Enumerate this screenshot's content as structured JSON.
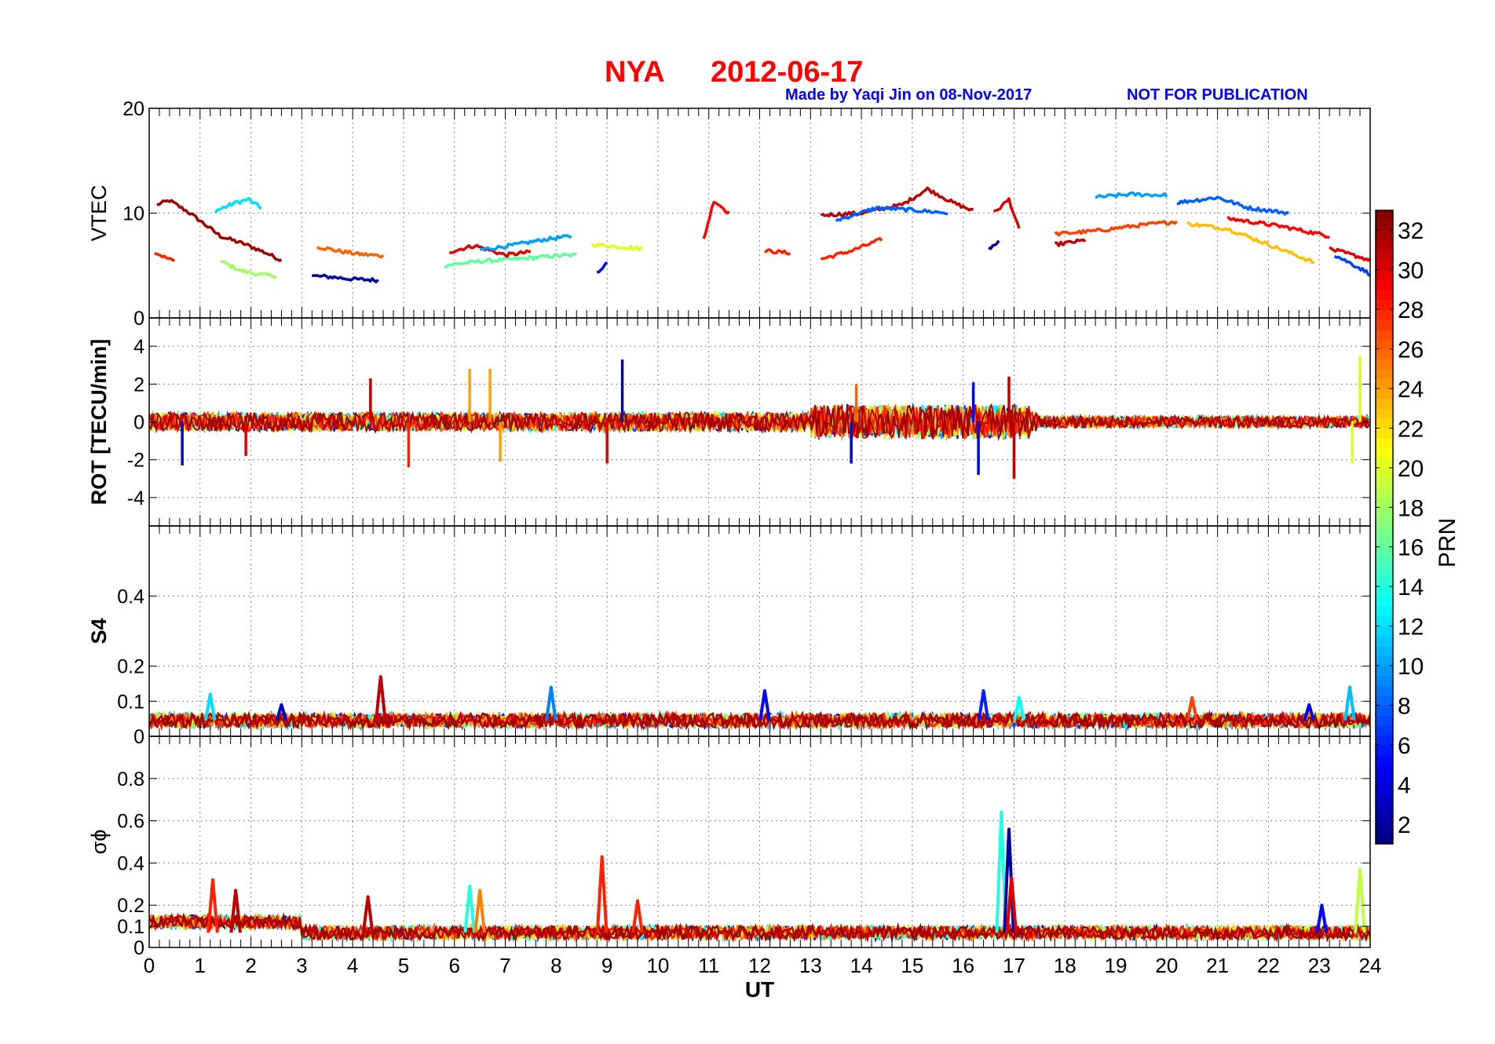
{
  "title": {
    "station": "NYA",
    "date": "2012-06-17"
  },
  "credit": {
    "made_by": "Made by Yaqi Jin on 08-Nov-2017",
    "notice": "NOT FOR PUBLICATION"
  },
  "colorbar": {
    "label": "PRN",
    "ticks": [
      "2",
      "4",
      "6",
      "8",
      "10",
      "12",
      "14",
      "16",
      "18",
      "20",
      "22",
      "24",
      "26",
      "28",
      "30",
      "32"
    ],
    "range": [
      1,
      33
    ],
    "colormap": "jet"
  },
  "chart_data": [
    {
      "type": "line",
      "panel": "vtec",
      "ylabel": "VTEC",
      "ylim": [
        0,
        20
      ],
      "yticks": [
        "0",
        "10",
        "20"
      ],
      "xlim": [
        0,
        24
      ],
      "grid": true,
      "series": [
        {
          "prn": 32,
          "x": [
            0.15,
            0.4,
            0.8,
            1.4,
            1.9,
            2.3,
            2.6
          ],
          "y": [
            10.8,
            11.2,
            10.0,
            7.8,
            7.0,
            6.2,
            5.5
          ]
        },
        {
          "prn": 28,
          "x": [
            0.1,
            0.3,
            0.5
          ],
          "y": [
            6.3,
            5.8,
            5.4
          ]
        },
        {
          "prn": 12,
          "x": [
            1.3,
            1.7,
            1.95,
            2.2
          ],
          "y": [
            10.2,
            11.0,
            11.3,
            10.5
          ]
        },
        {
          "prn": 18,
          "x": [
            1.4,
            1.8,
            2.2,
            2.5
          ],
          "y": [
            5.4,
            4.5,
            4.1,
            4.0
          ]
        },
        {
          "prn": 2,
          "x": [
            3.2,
            3.6,
            4.0,
            4.5
          ],
          "y": [
            4.0,
            3.9,
            3.7,
            3.6
          ]
        },
        {
          "prn": 26,
          "x": [
            3.3,
            3.7,
            4.1,
            4.6
          ],
          "y": [
            6.8,
            6.4,
            6.1,
            5.9
          ]
        },
        {
          "prn": 16,
          "x": [
            5.8,
            6.5,
            7.2,
            7.9,
            8.4
          ],
          "y": [
            5.0,
            5.4,
            5.6,
            5.9,
            6.0
          ]
        },
        {
          "prn": 30,
          "x": [
            5.9,
            6.4,
            7.0,
            7.5
          ],
          "y": [
            6.3,
            6.9,
            6.0,
            6.3
          ]
        },
        {
          "prn": 10,
          "x": [
            6.5,
            7.1,
            7.8,
            8.3
          ],
          "y": [
            6.5,
            6.9,
            7.5,
            7.8
          ]
        },
        {
          "prn": 20,
          "x": [
            8.7,
            9.2,
            9.7
          ],
          "y": [
            7.0,
            6.8,
            6.6
          ]
        },
        {
          "prn": 4,
          "x": [
            8.8,
            9.0
          ],
          "y": [
            4.4,
            5.2
          ]
        },
        {
          "prn": 29,
          "x": [
            10.9,
            11.1,
            11.4
          ],
          "y": [
            7.5,
            11.2,
            10.0
          ]
        },
        {
          "prn": 28,
          "x": [
            12.1,
            12.6
          ],
          "y": [
            6.4,
            6.2
          ]
        },
        {
          "prn": 28,
          "x": [
            13.2,
            13.8,
            14.4
          ],
          "y": [
            5.6,
            6.4,
            7.5
          ]
        },
        {
          "prn": 31,
          "x": [
            13.2,
            14.0,
            14.8,
            15.3,
            15.8,
            16.2
          ],
          "y": [
            9.8,
            10.0,
            10.8,
            12.3,
            11.0,
            10.2
          ]
        },
        {
          "prn": 8,
          "x": [
            13.5,
            14.3,
            15.0,
            15.7
          ],
          "y": [
            9.3,
            10.5,
            10.3,
            10.0
          ]
        },
        {
          "prn": 30,
          "x": [
            16.6,
            16.9,
            17.1
          ],
          "y": [
            10.0,
            11.3,
            8.4
          ]
        },
        {
          "prn": 2,
          "x": [
            16.5,
            16.7
          ],
          "y": [
            6.6,
            7.2
          ]
        },
        {
          "prn": 31,
          "x": [
            17.8,
            18.4
          ],
          "y": [
            7.0,
            7.4
          ]
        },
        {
          "prn": 10,
          "x": [
            18.6,
            19.3,
            20.0
          ],
          "y": [
            11.5,
            11.8,
            11.7
          ]
        },
        {
          "prn": 27,
          "x": [
            17.8,
            18.6,
            19.4,
            20.2
          ],
          "y": [
            8.0,
            8.3,
            8.8,
            9.2
          ]
        },
        {
          "prn": 8,
          "x": [
            20.2,
            21.0,
            21.6,
            22.4
          ],
          "y": [
            11.0,
            11.5,
            10.5,
            10.0
          ]
        },
        {
          "prn": 23,
          "x": [
            20.4,
            21.2,
            22.0,
            22.9
          ],
          "y": [
            9.0,
            8.5,
            7.0,
            5.3
          ]
        },
        {
          "prn": 29,
          "x": [
            21.2,
            22.3,
            23.2
          ],
          "y": [
            9.5,
            8.7,
            7.8
          ]
        },
        {
          "prn": 7,
          "x": [
            23.3,
            23.7,
            24.0
          ],
          "y": [
            6.0,
            5.0,
            4.2
          ]
        },
        {
          "prn": 30,
          "x": [
            23.2,
            23.8,
            24.0
          ],
          "y": [
            6.6,
            5.8,
            5.5
          ]
        }
      ]
    },
    {
      "type": "line",
      "panel": "rot",
      "ylabel": "ROT [TECU/min]",
      "ylim": [
        -5.5,
        5.5
      ],
      "yticks": [
        "-4",
        "-2",
        "0",
        "2",
        "4"
      ],
      "xlim": [
        0,
        24
      ],
      "grid": true,
      "spikes": [
        {
          "prn": 3,
          "x": 0.65,
          "y": -2.3
        },
        {
          "prn": 30,
          "x": 1.9,
          "y": -1.8
        },
        {
          "prn": 31,
          "x": 4.35,
          "y": 2.3
        },
        {
          "prn": 28,
          "x": 5.1,
          "y": -2.4
        },
        {
          "prn": 24,
          "x": 6.3,
          "y": 2.8
        },
        {
          "prn": 24,
          "x": 6.7,
          "y": 2.8
        },
        {
          "prn": 24,
          "x": 6.9,
          "y": -2.1
        },
        {
          "prn": 3,
          "x": 9.3,
          "y": 3.3
        },
        {
          "prn": 30,
          "x": 9.0,
          "y": -2.2
        },
        {
          "prn": 26,
          "x": 13.9,
          "y": 2.0
        },
        {
          "prn": 4,
          "x": 13.8,
          "y": -2.2
        },
        {
          "prn": 4,
          "x": 16.2,
          "y": 2.1
        },
        {
          "prn": 4,
          "x": 16.3,
          "y": -2.8
        },
        {
          "prn": 31,
          "x": 16.9,
          "y": 2.4
        },
        {
          "prn": 31,
          "x": 17.0,
          "y": -3.0
        },
        {
          "prn": 20,
          "x": 23.8,
          "y": 3.5
        },
        {
          "prn": 20,
          "x": 23.65,
          "y": -2.2
        }
      ]
    },
    {
      "type": "line",
      "panel": "s4",
      "ylabel": "S4",
      "ylim": [
        0,
        0.6
      ],
      "yticks": [
        "0",
        "0.1",
        "0.2",
        "0.4"
      ],
      "xlim": [
        0,
        24
      ],
      "grid": true,
      "peaks": [
        {
          "prn": 12,
          "x": 1.2,
          "y": 0.12
        },
        {
          "prn": 3,
          "x": 2.6,
          "y": 0.09
        },
        {
          "prn": 31,
          "x": 4.55,
          "y": 0.17
        },
        {
          "prn": 9,
          "x": 7.9,
          "y": 0.14
        },
        {
          "prn": 5,
          "x": 12.1,
          "y": 0.13
        },
        {
          "prn": 6,
          "x": 16.4,
          "y": 0.13
        },
        {
          "prn": 13,
          "x": 17.1,
          "y": 0.11
        },
        {
          "prn": 27,
          "x": 20.5,
          "y": 0.11
        },
        {
          "prn": 4,
          "x": 22.8,
          "y": 0.09
        },
        {
          "prn": 11,
          "x": 23.6,
          "y": 0.14
        }
      ]
    },
    {
      "type": "line",
      "panel": "sigma_phi",
      "ylabel": "σϕ",
      "ylim": [
        0,
        1.0
      ],
      "yticks": [
        "0",
        "0.1",
        "0.2",
        "0.4",
        "0.6",
        "0.8"
      ],
      "xlim": [
        0,
        24
      ],
      "xticks": [
        "0",
        "1",
        "2",
        "3",
        "4",
        "5",
        "6",
        "7",
        "8",
        "9",
        "10",
        "11",
        "12",
        "13",
        "14",
        "15",
        "16",
        "17",
        "18",
        "19",
        "20",
        "21",
        "22",
        "23",
        "24"
      ],
      "xlabel": "UT",
      "grid": true,
      "peaks": [
        {
          "prn": 28,
          "x": 1.25,
          "y": 0.32
        },
        {
          "prn": 31,
          "x": 1.7,
          "y": 0.27
        },
        {
          "prn": 31,
          "x": 4.3,
          "y": 0.24
        },
        {
          "prn": 14,
          "x": 6.3,
          "y": 0.29
        },
        {
          "prn": 25,
          "x": 6.5,
          "y": 0.27
        },
        {
          "prn": 28,
          "x": 8.9,
          "y": 0.43
        },
        {
          "prn": 28,
          "x": 9.6,
          "y": 0.22
        },
        {
          "prn": 14,
          "x": 16.75,
          "y": 0.64
        },
        {
          "prn": 2,
          "x": 16.9,
          "y": 0.56
        },
        {
          "prn": 30,
          "x": 16.95,
          "y": 0.33
        },
        {
          "prn": 5,
          "x": 23.05,
          "y": 0.2
        },
        {
          "prn": 19,
          "x": 23.8,
          "y": 0.37
        }
      ]
    }
  ]
}
